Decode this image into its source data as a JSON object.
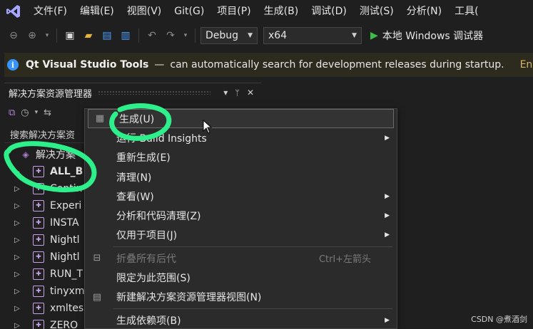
{
  "menubar": {
    "items": [
      "文件(F)",
      "编辑(E)",
      "视图(V)",
      "Git(G)",
      "项目(P)",
      "生成(B)",
      "调试(D)",
      "测试(S)",
      "分析(N)",
      "工具("
    ]
  },
  "toolbar": {
    "config": "Debug",
    "platform": "x64",
    "run_label": "本地 Windows 调试器"
  },
  "infobar": {
    "title": "Qt Visual Studio Tools",
    "dash": "—",
    "message": "can automatically search for development releases during startup.",
    "link": "En"
  },
  "solution_explorer": {
    "title": "解决方案资源管理器",
    "pin": "📌",
    "close": "✕",
    "dropdown": "▾",
    "search_placeholder": "搜索解决方案资",
    "solution_label": "解决方案",
    "items": [
      {
        "label": "ALL_B",
        "bold": true
      },
      {
        "label": "Contin",
        "bold": false
      },
      {
        "label": "Experi",
        "bold": false
      },
      {
        "label": "INSTA",
        "bold": false
      },
      {
        "label": "Nightl",
        "bold": false
      },
      {
        "label": "Nightl",
        "bold": false
      },
      {
        "label": "RUN_T",
        "bold": false
      },
      {
        "label": "tinyxm",
        "bold": false
      },
      {
        "label": "xmltes",
        "bold": false
      },
      {
        "label": "ZERO",
        "bold": false
      }
    ]
  },
  "context_menu": {
    "items": [
      {
        "label": "生成(U)",
        "icon": "build-icon",
        "hover": true
      },
      {
        "label": "运行 Build Insights",
        "submenu": true
      },
      {
        "label": "重新生成(E)"
      },
      {
        "label": "清理(N)"
      },
      {
        "label": "查看(W)",
        "submenu": true
      },
      {
        "label": "分析和代码清理(Z)",
        "submenu": true
      },
      {
        "label": "仅用于项目(J)",
        "submenu": true
      },
      {
        "separator": true
      },
      {
        "label": "折叠所有后代",
        "shortcut": "Ctrl+左箭头",
        "disabled": true,
        "icon": "collapse-icon"
      },
      {
        "label": "限定为此范围(S)"
      },
      {
        "label": "新建解决方案资源管理器视图(N)",
        "icon": "new-view-icon"
      },
      {
        "separator": true
      },
      {
        "label": "生成依赖项(B)",
        "submenu": true
      }
    ]
  },
  "watermark": "CSDN @煮酒剑",
  "colors": {
    "background": "#1f1f1f",
    "menu_bg": "#2b2b2b",
    "annotation_green": "#2ef08a",
    "infobar_bg": "#2d2a1e"
  }
}
